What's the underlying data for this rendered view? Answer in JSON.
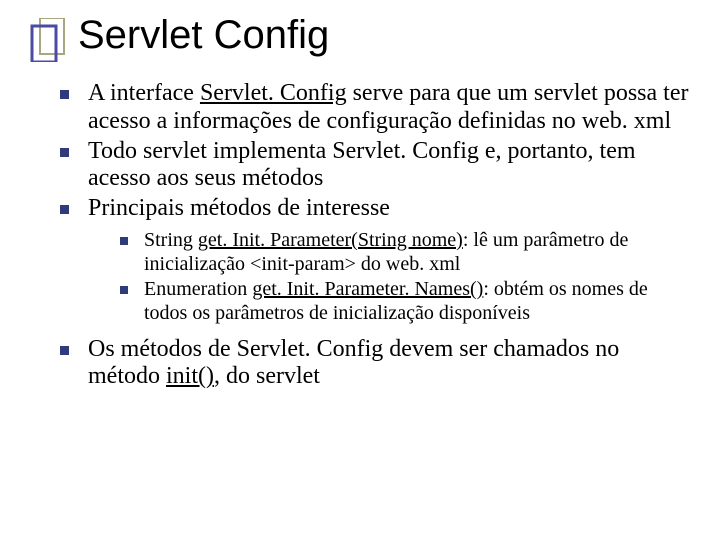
{
  "title": "Servlet Config",
  "bullets": [
    {
      "segments": [
        {
          "text": "A interface "
        },
        {
          "text": "Servlet. Config",
          "underline": true
        },
        {
          "text": " serve para que um servlet possa ter acesso a informações de configuração definidas no web. xml"
        }
      ]
    },
    {
      "segments": [
        {
          "text": "Todo servlet implementa Servlet. Config e, portanto, tem acesso aos seus métodos"
        }
      ]
    },
    {
      "segments": [
        {
          "text": "Principais métodos de interesse"
        }
      ],
      "children": [
        {
          "segments": [
            {
              "text": "String "
            },
            {
              "text": "get. Init. Parameter(String nome)",
              "underline": true
            },
            {
              "text": ": lê um parâmetro de inicialização <init-param> do web. xml"
            }
          ]
        },
        {
          "segments": [
            {
              "text": "Enumeration "
            },
            {
              "text": "get. Init. Parameter. Names()",
              "underline": true
            },
            {
              "text": ": obtém os nomes de todos os parâmetros de inicialização disponíveis"
            }
          ]
        }
      ]
    },
    {
      "segments": [
        {
          "text": "Os métodos de Servlet. Config devem ser chamados no método "
        },
        {
          "text": "init()",
          "underline": true
        },
        {
          "text": ", do servlet"
        }
      ]
    }
  ]
}
